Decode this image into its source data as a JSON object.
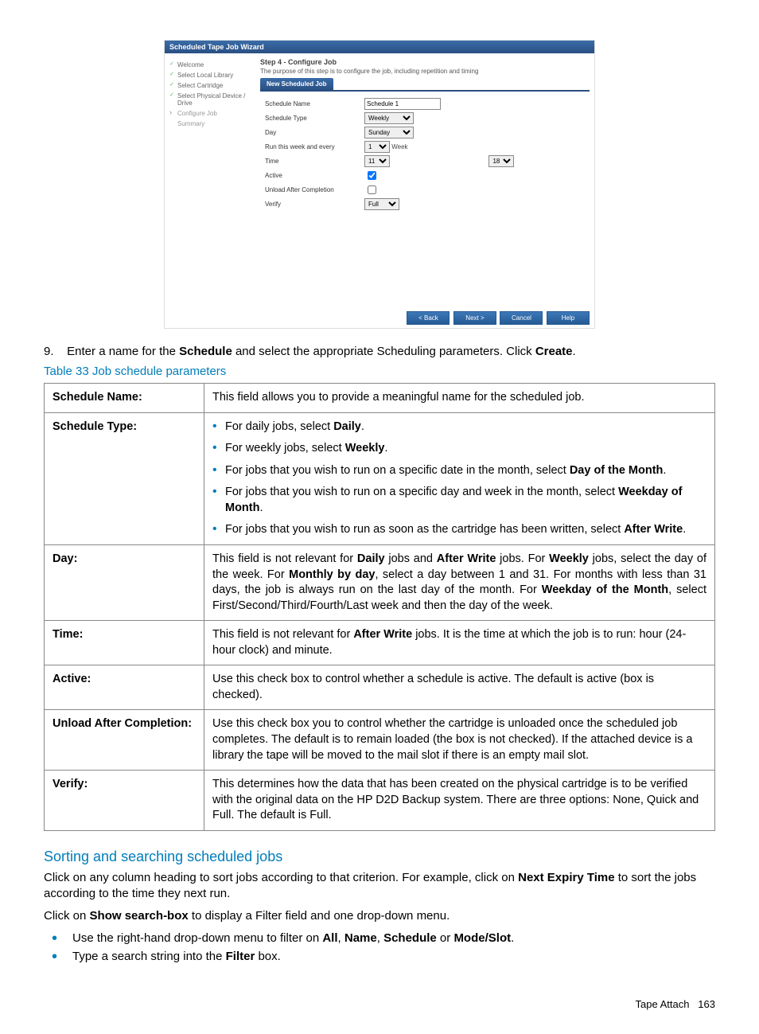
{
  "wizard": {
    "title": "Scheduled Tape Job Wizard",
    "sidebar": [
      "Welcome",
      "Select Local Library",
      "Select Cartridge",
      "Select Physical Device / Drive",
      "Configure Job",
      "Summary"
    ],
    "step_title": "Step 4 - Configure Job",
    "step_desc": "The purpose of this step is to configure the job, including repetition and timing",
    "tab": "New Scheduled Job",
    "form": {
      "schedule_name_label": "Schedule Name",
      "schedule_name_value": "Schedule 1",
      "schedule_type_label": "Schedule Type",
      "schedule_type_value": "Weekly",
      "day_label": "Day",
      "day_value": "Sunday",
      "runevery_label": "Run this week and every",
      "runevery_value": "1",
      "runevery_suffix": "Week",
      "time_label": "Time",
      "time_hour": "11",
      "time_minute": "18",
      "active_label": "Active",
      "active_checked": true,
      "unload_label": "Unload After Completion",
      "unload_checked": false,
      "verify_label": "Verify",
      "verify_value": "Full"
    },
    "buttons": {
      "back": "< Back",
      "next": "Next >",
      "cancel": "Cancel",
      "help": "Help"
    }
  },
  "step9": {
    "num": "9.",
    "prefix": "Enter a name for the ",
    "b1": "Schedule",
    "mid": " and select the appropriate Scheduling parameters. Click ",
    "b2": "Create",
    "suffix": "."
  },
  "table_caption": "Table 33 Job schedule parameters",
  "rows": {
    "r1_label": "Schedule Name:",
    "r1_text": "This field allows you to provide a meaningful name for the scheduled job.",
    "r2_label": "Schedule Type:",
    "r2_items": {
      "i1a": "For daily jobs, select ",
      "i1b": "Daily",
      "i1c": ".",
      "i2a": "For weekly jobs, select ",
      "i2b": "Weekly",
      "i2c": ".",
      "i3a": "For jobs that you wish to run on a specific date in the month, select ",
      "i3b": "Day of the Month",
      "i3c": ".",
      "i4a": "For jobs that you wish to run on a specific day and week in the month, select ",
      "i4b": "Weekday of Month",
      "i4c": ".",
      "i5a": "For jobs that you wish to run as soon as the cartridge has been written, select ",
      "i5b": "After Write",
      "i5c": "."
    },
    "r3_label": "Day:",
    "r3": {
      "a": "This field is not relevant for ",
      "b1": "Daily",
      "c": " jobs and ",
      "b2": "After Write",
      "d": " jobs. For ",
      "b3": "Weekly",
      "e": " jobs, select the day of the week. For ",
      "b4": "Monthly by day",
      "f": ", select a day between 1 and 31. For months with less than 31 days, the job is always run on the last day of the month. For ",
      "b5": "Weekday of the Month",
      "g": ", select First/Second/Third/Fourth/Last week and then the day of the week."
    },
    "r4_label": "Time:",
    "r4": {
      "a": "This field is not relevant for ",
      "b1": "After Write",
      "c": " jobs. It is the time at which the job is to run: hour (24-hour clock) and minute."
    },
    "r5_label": "Active:",
    "r5_text": "Use this check box to control whether a schedule is active. The default is active (box is checked).",
    "r6_label": "Unload After Completion:",
    "r6_text": "Use this check box you to control whether the cartridge is unloaded once the scheduled job completes. The default is to remain loaded (the box is not checked). If the attached device is a library the tape will be moved to the mail slot if there is an empty mail slot.",
    "r7_label": "Verify:",
    "r7_text": "This determines how the data that has been created on the physical cartridge is to be verified with the original data on the HP D2D Backup system. There are three options: None, Quick and Full. The default is Full."
  },
  "section_title": "Sorting and searching scheduled jobs",
  "p1": {
    "a": "Click on any column heading to sort jobs according to that criterion. For example, click on ",
    "b1": "Next Expiry Time",
    "c": " to sort the jobs according to the time they next run."
  },
  "p2": {
    "a": "Click on ",
    "b1": "Show search-box",
    "c": " to display a Filter field and one drop-down menu."
  },
  "bullets": {
    "b1": {
      "a": "Use the right-hand drop-down menu to filter on ",
      "w1": "All",
      "c1": ", ",
      "w2": "Name",
      "c2": ", ",
      "w3": "Schedule",
      "c3": " or ",
      "w4": "Mode/Slot",
      "c4": "."
    },
    "b2": {
      "a": "Type a search string into the ",
      "w1": "Filter",
      "c": " box."
    }
  },
  "footer": {
    "label": "Tape Attach",
    "page": "163"
  }
}
